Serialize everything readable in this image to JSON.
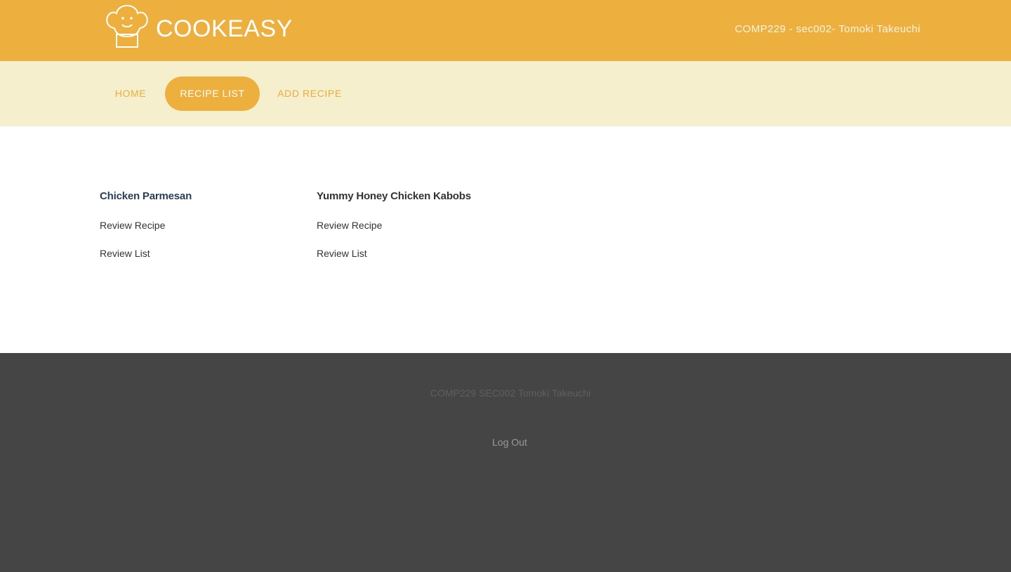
{
  "header": {
    "brand": "COOKEASY",
    "course_info": "COMP229 - sec002- Tomoki Takeuchi",
    "logo_icon": "chef-hat-icon"
  },
  "nav": {
    "items": [
      {
        "label": "HOME",
        "active": false
      },
      {
        "label": "RECIPE LIST",
        "active": true
      },
      {
        "label": "ADD RECIPE",
        "active": false
      }
    ]
  },
  "recipes": [
    {
      "title": "Chicken Parmesan",
      "review_recipe": "Review Recipe",
      "review_list": "Review List"
    },
    {
      "title": "Yummy Honey Chicken Kabobs",
      "review_recipe": "Review Recipe",
      "review_list": "Review List"
    }
  ],
  "footer": {
    "credit": "COMP229 SEC002 Tomoki Takeuchi",
    "logout": "Log Out"
  },
  "colors": {
    "accent": "#edb03f",
    "nav_background": "#f5efcd",
    "footer_background": "#454545"
  }
}
